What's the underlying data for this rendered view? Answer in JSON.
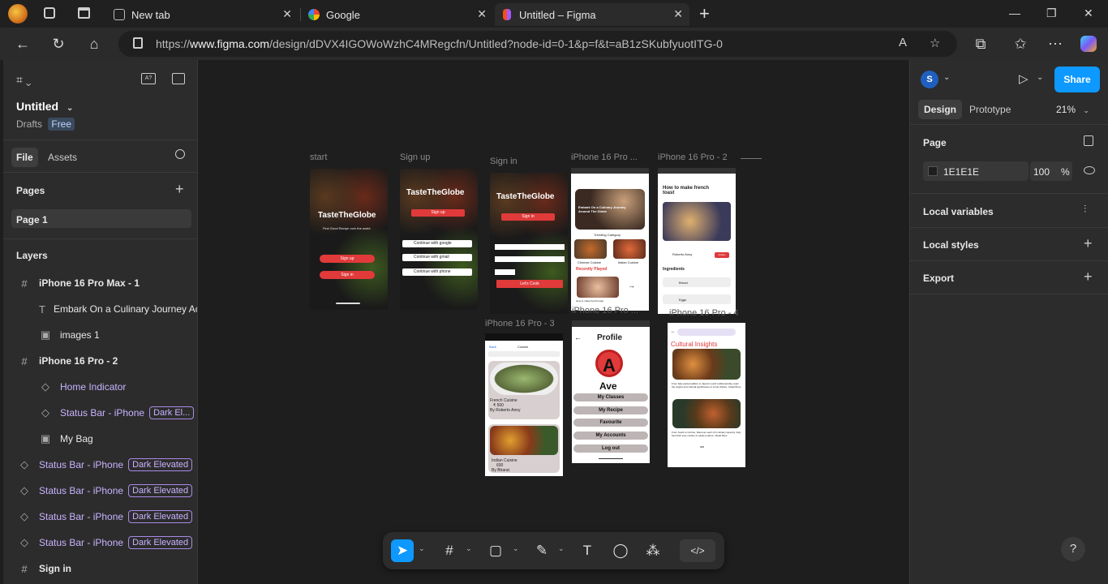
{
  "browser": {
    "tabs": [
      {
        "label": "New tab"
      },
      {
        "label": "Google"
      },
      {
        "label": "Untitled – Figma"
      }
    ],
    "url_prefix": "https://",
    "url_domain": "www.figma.com",
    "url_path": "/design/dDVX4IGOWoWzhC4MRegcfn/Untitled?node-id=0-1&p=f&t=aB1zSKubfyuotITG-0"
  },
  "file": {
    "name": "Untitled",
    "location": "Drafts",
    "plan": "Free"
  },
  "leftpanel": {
    "tab_file": "File",
    "tab_assets": "Assets",
    "pages_heading": "Pages",
    "page_item": "Page 1",
    "layers_heading": "Layers",
    "layers": [
      {
        "name": "iPhone 16 Pro Max - 1",
        "icon": "frame-icon",
        "indent": 0,
        "bold": true
      },
      {
        "name": "Embark On a Culinary Journey Ac",
        "icon": "text-icon",
        "indent": 1
      },
      {
        "name": "images 1",
        "icon": "image-icon",
        "indent": 1
      },
      {
        "name": "iPhone 16 Pro - 2",
        "icon": "frame-icon",
        "indent": 0,
        "bold": true
      },
      {
        "name": "Home Indicator",
        "icon": "component-icon",
        "indent": 1,
        "purple": true
      },
      {
        "name": "Status Bar - iPhone",
        "chip": "Dark El...",
        "icon": "component-icon",
        "indent": 1,
        "purple": true
      },
      {
        "name": "My Bag",
        "icon": "image-icon",
        "indent": 1
      },
      {
        "name": "Status Bar - iPhone",
        "chip": "Dark Elevated",
        "icon": "component-icon",
        "indent": 0,
        "purple": true
      },
      {
        "name": "Status Bar - iPhone",
        "chip": "Dark Elevated",
        "icon": "component-icon",
        "indent": 0,
        "purple": true
      },
      {
        "name": "Status Bar - iPhone",
        "chip": "Dark Elevated",
        "icon": "component-icon",
        "indent": 0,
        "purple": true
      },
      {
        "name": "Status Bar - iPhone",
        "chip": "Dark Elevated",
        "icon": "component-icon",
        "indent": 0,
        "purple": true
      },
      {
        "name": "Sign in",
        "icon": "frame-icon",
        "indent": 0,
        "bold": true
      }
    ]
  },
  "rightpanel": {
    "avatar": "S",
    "share": "Share",
    "tab_design": "Design",
    "tab_prototype": "Prototype",
    "zoom": "21%",
    "page_heading": "Page",
    "page_color": "1E1E1E",
    "page_opacity": "100",
    "percent": "%",
    "local_variables": "Local variables",
    "local_styles": "Local styles",
    "export": "Export",
    "help": "?"
  },
  "canvas": {
    "labels": {
      "start": "start",
      "signup": "Sign up",
      "signin": "Sign in",
      "i16pro": "iPhone 16 Pro ...",
      "i16pro2": "iPhone 16 Pro - 2",
      "i16pro3": "iPhone 16 Pro - 3"
    },
    "app_title": "TasteTheGlobe",
    "tagline": "Find Good Recipe over the world",
    "signup_btn": "Sign up",
    "signin_btn": "Sign in",
    "google": "Continue with google",
    "gmail": "Continue with gmail",
    "phone": "Continue with phone",
    "letscook": "Let's Cook",
    "embark": "Embark On a Culinary Journey Around The Globe",
    "trending": "Trending Category",
    "seeall": "See all",
    "chinese": "Chinese Cuisine",
    "italian": "Italian Cuisine",
    "recently": "Recently Played",
    "howto_small": "How to make french toast",
    "howto": "How to make french toast",
    "author": "Roberto Anny",
    "follow": "Follow",
    "ingredients": "Ingredients",
    "bread": "Bread",
    "eggs": "Eggs",
    "back": "Back",
    "cuisine_hdr": "Cuisine",
    "french": "French Cuisine",
    "french_price": "₹ 500",
    "french_by": "By Roberto Anny",
    "indian": "Indian Cuisine",
    "indian_price": "600",
    "indian_by": "By Bharat",
    "profile": "Profile",
    "avatar_letter": "A",
    "profile_name": "Ave",
    "menu": [
      "My Classes",
      "My Recipe",
      "Favourite",
      "My Accounts",
      "Log out"
    ],
    "cultural": "Cultural Insights",
    "cultural_text1": "From Italy pasta tradition to Japan's sushi craftsmanship, learn the origins and cultural significance of iconic dishes...Read More",
    "cultural_text2": "From Sushi to Curries, Discover each rich culinary tapestry. Italy best dish ever cuisine to easily explore...Read More"
  },
  "colors": {
    "accent": "#0d99ff",
    "red": "#e03a3a",
    "purple": "#c9b3ff"
  }
}
